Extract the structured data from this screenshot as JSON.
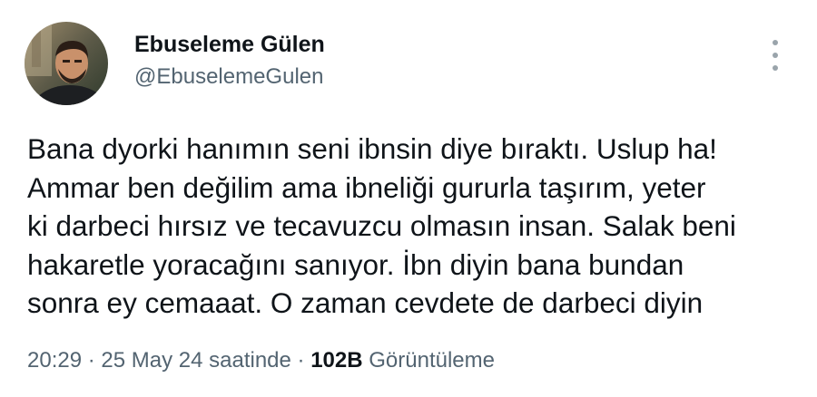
{
  "author": {
    "display_name": "Ebuseleme Gülen",
    "handle": "@EbuselemeGulen"
  },
  "more_icon": "vertical-ellipsis-icon",
  "tweet": {
    "lines": [
      "Bana dyorki hanımın seni ibnsin diye bıraktı. Uslup ha!",
      "Ammar ben değilim ama ibneliği gururla taşırım, yeter",
      "ki darbeci hırsız ve tecavuzcu olmasın insan. Salak beni",
      "hakaretle yoracağını sanıyor. İbn diyin bana bundan",
      "sonra ey cemaaat. O zaman cevdete de darbeci diyin"
    ]
  },
  "meta": {
    "time": "20:29",
    "separator": " · ",
    "date_text": "25 May 24 saatinde",
    "views_count": "102B",
    "views_label": "Görüntüleme"
  },
  "colors": {
    "text_primary": "#0f1419",
    "text_secondary": "#536471",
    "icon_gray": "#9aa4ab"
  }
}
